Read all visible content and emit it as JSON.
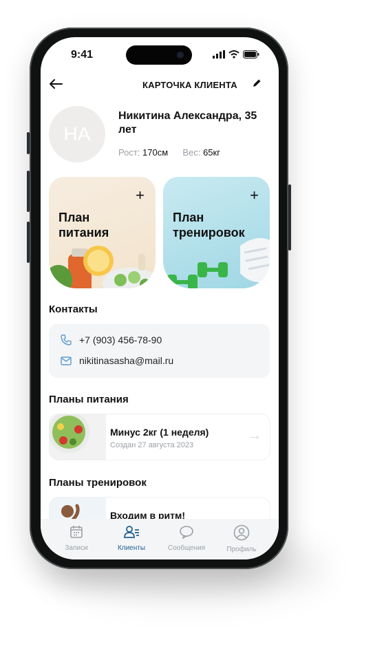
{
  "status": {
    "time": "9:41"
  },
  "header": {
    "title": "КАРТОЧКА КЛИЕНТА",
    "back_icon": "arrow-left-icon",
    "edit_icon": "pencil-icon"
  },
  "client": {
    "initials": "НА",
    "name": "Никитина Александра, 35 лет",
    "height_label": "Рост:",
    "height_value": "170см",
    "weight_label": "Вес:",
    "weight_value": "65кг"
  },
  "tiles": {
    "nutrition": {
      "label_line1": "План",
      "label_line2": "питания"
    },
    "training": {
      "label_line1": "План",
      "label_line2": "тренировок"
    }
  },
  "contacts": {
    "title": "Контакты",
    "phone": "+7 (903) 456-78-90",
    "email": "nikitinasasha@mail.ru"
  },
  "nutrition_plans": {
    "title": "Планы питания",
    "items": [
      {
        "title": "Минус 2кг (1 неделя)",
        "subtitle": "Создан 27 августа 2023"
      }
    ]
  },
  "training_plans": {
    "title": "Планы тренировок",
    "items": [
      {
        "title": "Входим в ритм!"
      }
    ]
  },
  "tabbar": {
    "items": [
      {
        "label": "Записи",
        "icon": "calendar-icon"
      },
      {
        "label": "Клиенты",
        "icon": "clients-icon",
        "active": true
      },
      {
        "label": "Сообщения",
        "icon": "chat-icon"
      },
      {
        "label": "Профиль",
        "icon": "profile-icon"
      }
    ]
  },
  "colors": {
    "accent": "#1f5f92",
    "muted": "#9aa0a6",
    "surface": "#f4f5f6"
  }
}
